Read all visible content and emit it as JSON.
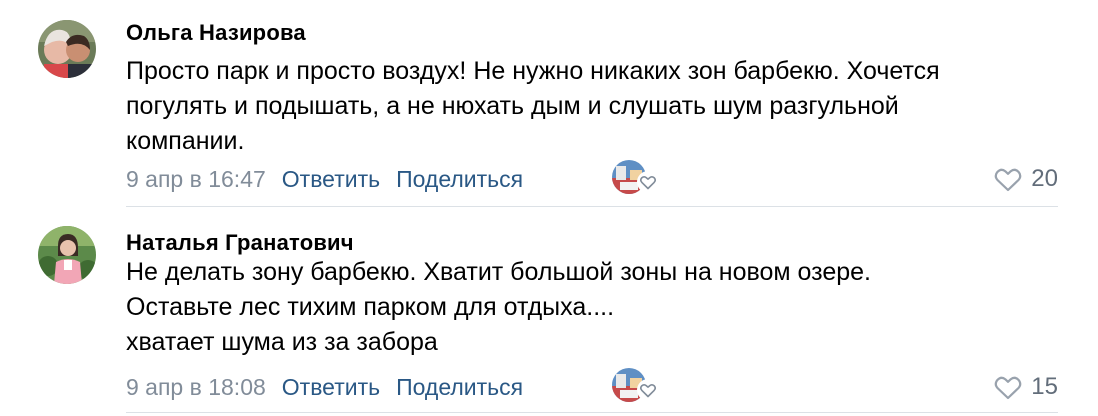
{
  "comments": [
    {
      "author": "Ольга Назирова",
      "lines": [
        "Просто парк и просто воздух! Не нужно никаких зон барбекю. Хочется",
        "погулять и подышать, а не нюхать дым и слушать шум разгульной",
        "компании."
      ],
      "date": "9 апр в 16:47",
      "reply_label": "Ответить",
      "share_label": "Поделиться",
      "likes": "20",
      "avatar_icon": "avatar-photo",
      "like_icon": "heart-outline-icon"
    },
    {
      "author": "Наталья Гранатович",
      "lines": [
        "Не делать зону барбекю. Хватит большой зоны на новом озере.",
        "Оставьте лес тихим парком для отдыха....",
        "хватает шума из за забора"
      ],
      "date": "9 апр в 18:08",
      "reply_label": "Ответить",
      "share_label": "Поделиться",
      "likes": "15",
      "avatar_icon": "avatar-photo",
      "like_icon": "heart-outline-icon"
    }
  ],
  "colors": {
    "link": "#2a5885",
    "meta_gray": "#818c99",
    "count_gray": "#626d7a",
    "divider": "#dce1e6"
  }
}
